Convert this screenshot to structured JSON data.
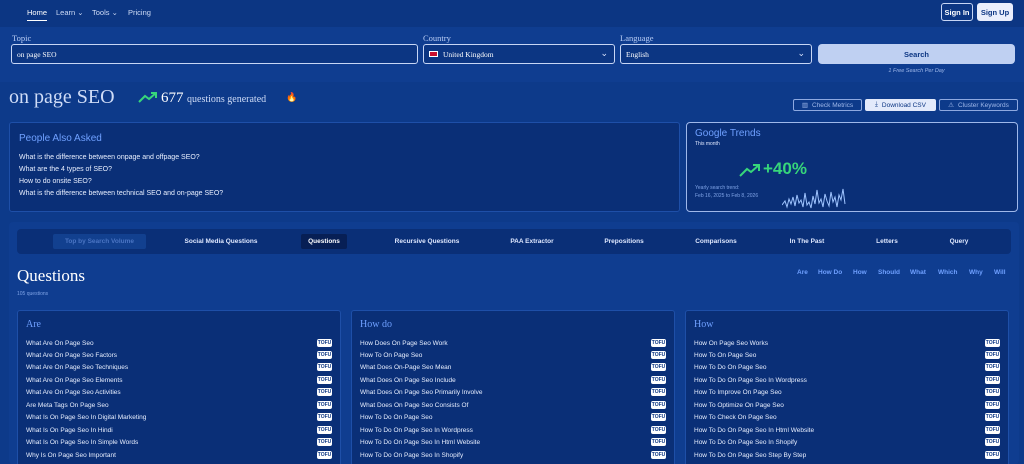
{
  "nav": {
    "home": "Home",
    "learn": "Learn ⌄",
    "tools": "Tools ⌄",
    "pricing": "Pricing",
    "sign_in": "Sign In",
    "sign_up": "Sign Up"
  },
  "search": {
    "topic_label": "Topic",
    "topic_value": "on page SEO",
    "country_label": "Country",
    "country_value": "United Kingdom",
    "language_label": "Language",
    "language_value": "English",
    "search_button": "Search",
    "note": "1 Free Search Per Day"
  },
  "result": {
    "title": "on page SEO",
    "count": "677",
    "count_text": "questions generated"
  },
  "actions": {
    "check_metrics": "Check Metrics",
    "download_csv": "Download CSV",
    "cluster_keywords": "Cluster Keywords"
  },
  "paa": {
    "title": "People Also Asked",
    "questions": [
      "What is the difference between onpage and offpage SEO?",
      "What are the 4 types of SEO?",
      "How to do onsite SEO?",
      "What is the difference between technical SEO and on-page SEO?"
    ]
  },
  "trends": {
    "title": "Google Trends",
    "period": "This month",
    "change": "+40%",
    "yearly_label": "Yearly search trend:",
    "range": "Feb 16, 2025 to Feb 8, 2026"
  },
  "tabs": [
    "Top by Search Volume",
    "Social Media Questions",
    "Questions",
    "Recursive Questions",
    "PAA Extractor",
    "Prepositions",
    "Comparisons",
    "In The Past",
    "Letters",
    "Query"
  ],
  "questions_section": {
    "title": "Questions",
    "count": "105 questions"
  },
  "filters": [
    "Are",
    "How Do",
    "How",
    "Should",
    "What",
    "Which",
    "Why",
    "Will"
  ],
  "columns": [
    {
      "title": "Are",
      "items": [
        "What Are On Page Seo",
        "What Are On Page Seo Factors",
        "What Are On Page Seo Techniques",
        "What Are On Page Seo Elements",
        "What Are On Page Seo Activities",
        "Are Meta Tags On Page Seo",
        "What Is On Page Seo In Digital Marketing",
        "What Is On Page Seo In Hindi",
        "What Is On Page Seo In Simple Words",
        "Why Is On Page Seo Important"
      ]
    },
    {
      "title": "How do",
      "items": [
        "How Does On Page Seo Work",
        "How To On Page Seo",
        "What Does On-Page Seo Mean",
        "What Does On Page Seo Include",
        "What Does On Page Seo Primarily Involve",
        "What Does On Page Seo Consists Of",
        "How To Do On Page Seo",
        "How To Do On Page Seo In Wordpress",
        "How To Do On Page Seo In Html Website",
        "How To Do On Page Seo In Shopify"
      ]
    },
    {
      "title": "How",
      "items": [
        "How On Page Seo Works",
        "How To On Page Seo",
        "How To Do On Page Seo",
        "How To Do On Page Seo In Wordpress",
        "How To Improve On Page Seo",
        "How To Optimize On Page Seo",
        "How To Check On Page Seo",
        "How To Do On Page Seo In Html Website",
        "How To Do On Page Seo In Shopify",
        "How To Do On Page Seo Step By Step"
      ]
    }
  ],
  "badge": "TOFU",
  "colors": {
    "background": "#0d3a8a",
    "accent": "#6fa0ff",
    "positive": "#37d67a"
  },
  "icons": {
    "trend": "trend-up-icon",
    "fire": "fire-icon",
    "flag": "uk-flag-icon"
  }
}
